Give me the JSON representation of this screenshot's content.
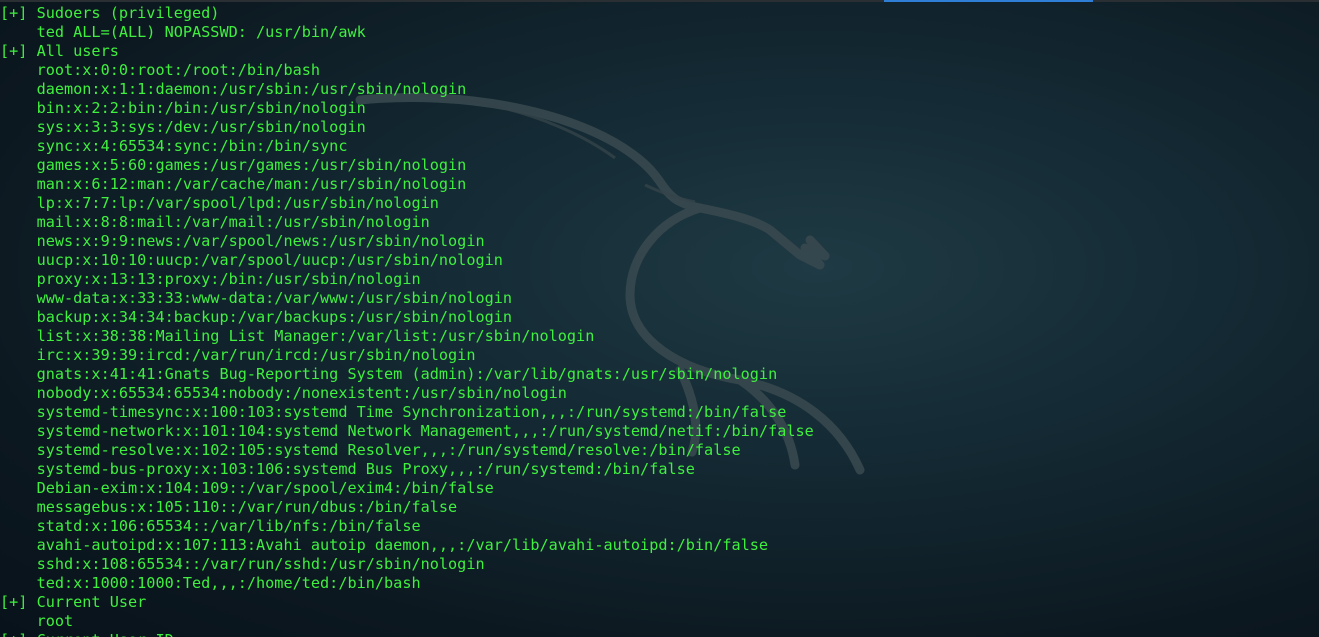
{
  "window": {
    "title": "",
    "colors": {
      "text": "#3ff03f",
      "background": "#0e1a22",
      "accent": "#2f7fd6"
    }
  },
  "terminal": {
    "lines": [
      "[+] Sudoers (privileged)",
      "    ted ALL=(ALL) NOPASSWD: /usr/bin/awk",
      "[+] All users",
      "    root:x:0:0:root:/root:/bin/bash",
      "    daemon:x:1:1:daemon:/usr/sbin:/usr/sbin/nologin",
      "    bin:x:2:2:bin:/bin:/usr/sbin/nologin",
      "    sys:x:3:3:sys:/dev:/usr/sbin/nologin",
      "    sync:x:4:65534:sync:/bin:/bin/sync",
      "    games:x:5:60:games:/usr/games:/usr/sbin/nologin",
      "    man:x:6:12:man:/var/cache/man:/usr/sbin/nologin",
      "    lp:x:7:7:lp:/var/spool/lpd:/usr/sbin/nologin",
      "    mail:x:8:8:mail:/var/mail:/usr/sbin/nologin",
      "    news:x:9:9:news:/var/spool/news:/usr/sbin/nologin",
      "    uucp:x:10:10:uucp:/var/spool/uucp:/usr/sbin/nologin",
      "    proxy:x:13:13:proxy:/bin:/usr/sbin/nologin",
      "    www-data:x:33:33:www-data:/var/www:/usr/sbin/nologin",
      "    backup:x:34:34:backup:/var/backups:/usr/sbin/nologin",
      "    list:x:38:38:Mailing List Manager:/var/list:/usr/sbin/nologin",
      "    irc:x:39:39:ircd:/var/run/ircd:/usr/sbin/nologin",
      "    gnats:x:41:41:Gnats Bug-Reporting System (admin):/var/lib/gnats:/usr/sbin/nologin",
      "    nobody:x:65534:65534:nobody:/nonexistent:/usr/sbin/nologin",
      "    systemd-timesync:x:100:103:systemd Time Synchronization,,,:/run/systemd:/bin/false",
      "    systemd-network:x:101:104:systemd Network Management,,,:/run/systemd/netif:/bin/false",
      "    systemd-resolve:x:102:105:systemd Resolver,,,:/run/systemd/resolve:/bin/false",
      "    systemd-bus-proxy:x:103:106:systemd Bus Proxy,,,:/run/systemd:/bin/false",
      "    Debian-exim:x:104:109::/var/spool/exim4:/bin/false",
      "    messagebus:x:105:110::/var/run/dbus:/bin/false",
      "    statd:x:106:65534::/var/lib/nfs:/bin/false",
      "    avahi-autoipd:x:107:113:Avahi autoip daemon,,,:/var/lib/avahi-autoipd:/bin/false",
      "    sshd:x:108:65534::/var/run/sshd:/usr/sbin/nologin",
      "    ted:x:1000:1000:Ted,,,:/home/ted:/bin/bash",
      "[+] Current User",
      "    root",
      "[+] Current User ID"
    ]
  },
  "background": {
    "logo_icon": "kali-dragon-icon"
  }
}
